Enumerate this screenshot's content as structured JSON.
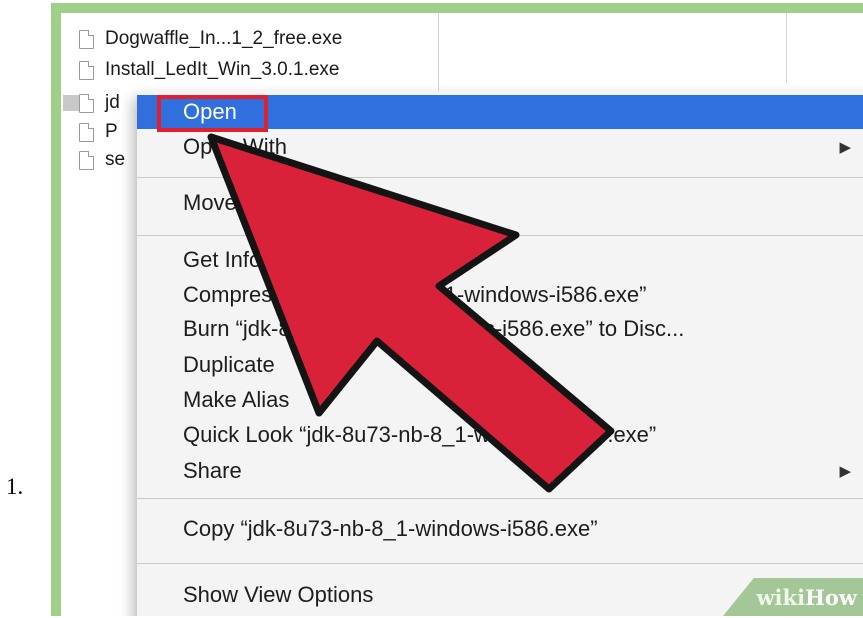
{
  "list_number": "1.",
  "files": [
    {
      "name": "Dogwaffle_In...1_2_free.exe"
    },
    {
      "name": "Install_LedIt_Win_3.0.1.exe"
    },
    {
      "name": "jd"
    },
    {
      "name": "P"
    },
    {
      "name": "se"
    }
  ],
  "menu": {
    "open": "Open",
    "open_with": "Open With",
    "move": "Move",
    "get_info": "Get Info",
    "compress": "Compress “jdk-8u73-nb-8_1-windows-i586.exe”",
    "burn": "Burn “jdk-8u73-nb-8_1-windows-i586.exe” to Disc...",
    "duplicate": "Duplicate",
    "make_alias": "Make Alias",
    "quick_look": "Quick Look “jdk-8u73-nb-8_1-windows-i586.exe”",
    "share": "Share",
    "copy": "Copy “jdk-8u73-nb-8_1-windows-i586.exe”",
    "show_view_options": "Show View Options",
    "submenu_glyph": "▶"
  },
  "watermark": {
    "wiki": "wiki",
    "how": "How"
  },
  "colors": {
    "frame_green": "#9fd089",
    "highlight_blue": "#2f6fde",
    "annotation_red": "#e0202d",
    "arrow_red": "#d9223a"
  },
  "icons": [
    "file-icon",
    "red-pointer-arrow",
    "chevron-right-icon"
  ]
}
